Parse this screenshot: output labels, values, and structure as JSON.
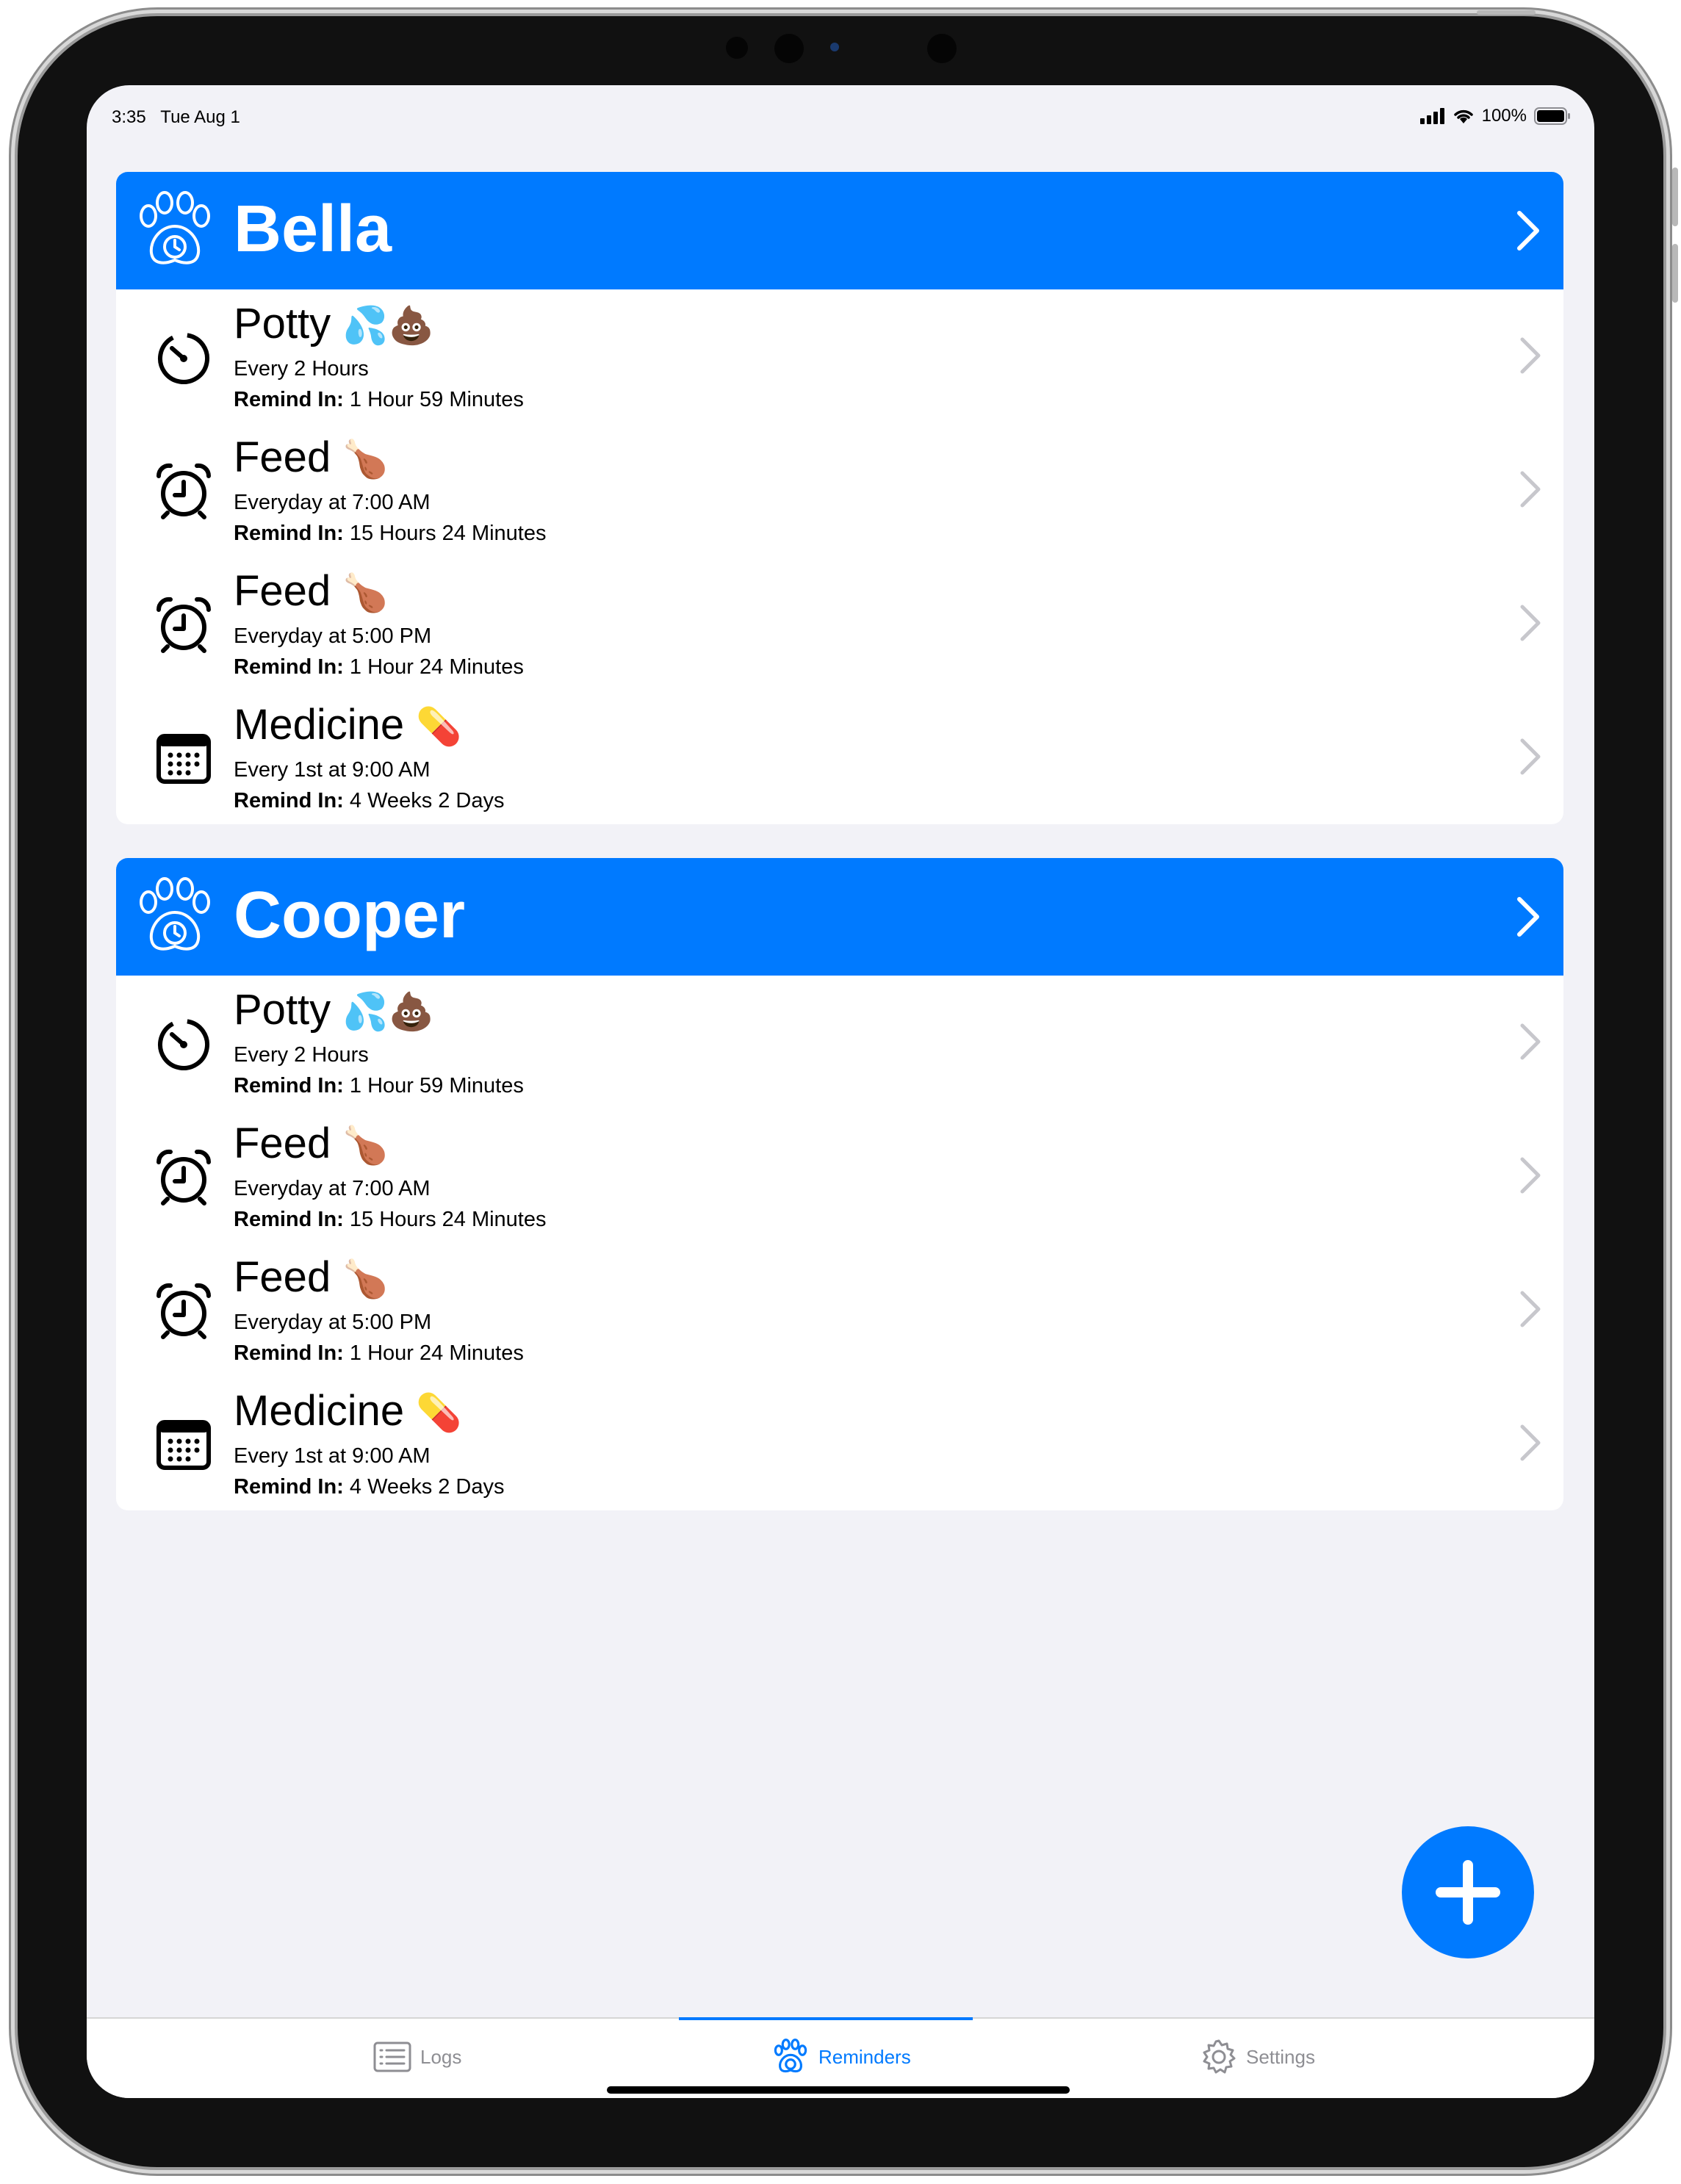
{
  "status_bar": {
    "time": "3:35",
    "date": "Tue Aug 1",
    "battery": "100%"
  },
  "colors": {
    "accent": "#007aff",
    "background": "#f2f2f7"
  },
  "pets": [
    {
      "name": "Bella",
      "reminders": [
        {
          "icon": "timer-icon",
          "title": "Potty",
          "emoji": "💦💩",
          "schedule": "Every 2 Hours",
          "remind_label": "Remind In:",
          "remind_value": " 1 Hour 59 Minutes"
        },
        {
          "icon": "alarm-clock-icon",
          "title": "Feed",
          "emoji": "🍗",
          "schedule": "Everyday at 7:00 AM",
          "remind_label": "Remind In:",
          "remind_value": " 15 Hours 24 Minutes"
        },
        {
          "icon": "alarm-clock-icon",
          "title": "Feed",
          "emoji": "🍗",
          "schedule": "Everyday at 5:00 PM",
          "remind_label": "Remind In:",
          "remind_value": " 1 Hour 24 Minutes"
        },
        {
          "icon": "calendar-icon",
          "title": "Medicine",
          "emoji": "💊",
          "schedule": "Every 1st at 9:00 AM",
          "remind_label": "Remind In:",
          "remind_value": " 4 Weeks 2 Days"
        }
      ]
    },
    {
      "name": "Cooper",
      "reminders": [
        {
          "icon": "timer-icon",
          "title": "Potty",
          "emoji": "💦💩",
          "schedule": "Every 2 Hours",
          "remind_label": "Remind In:",
          "remind_value": " 1 Hour 59 Minutes"
        },
        {
          "icon": "alarm-clock-icon",
          "title": "Feed",
          "emoji": "🍗",
          "schedule": "Everyday at 7:00 AM",
          "remind_label": "Remind In:",
          "remind_value": " 15 Hours 24 Minutes"
        },
        {
          "icon": "alarm-clock-icon",
          "title": "Feed",
          "emoji": "🍗",
          "schedule": "Everyday at 5:00 PM",
          "remind_label": "Remind In:",
          "remind_value": " 1 Hour 24 Minutes"
        },
        {
          "icon": "calendar-icon",
          "title": "Medicine",
          "emoji": "💊",
          "schedule": "Every 1st at 9:00 AM",
          "remind_label": "Remind In:",
          "remind_value": " 4 Weeks 2 Days"
        }
      ]
    }
  ],
  "tabbar": {
    "logs": "Logs",
    "reminders": "Reminders",
    "settings": "Settings",
    "selected": "reminders"
  }
}
